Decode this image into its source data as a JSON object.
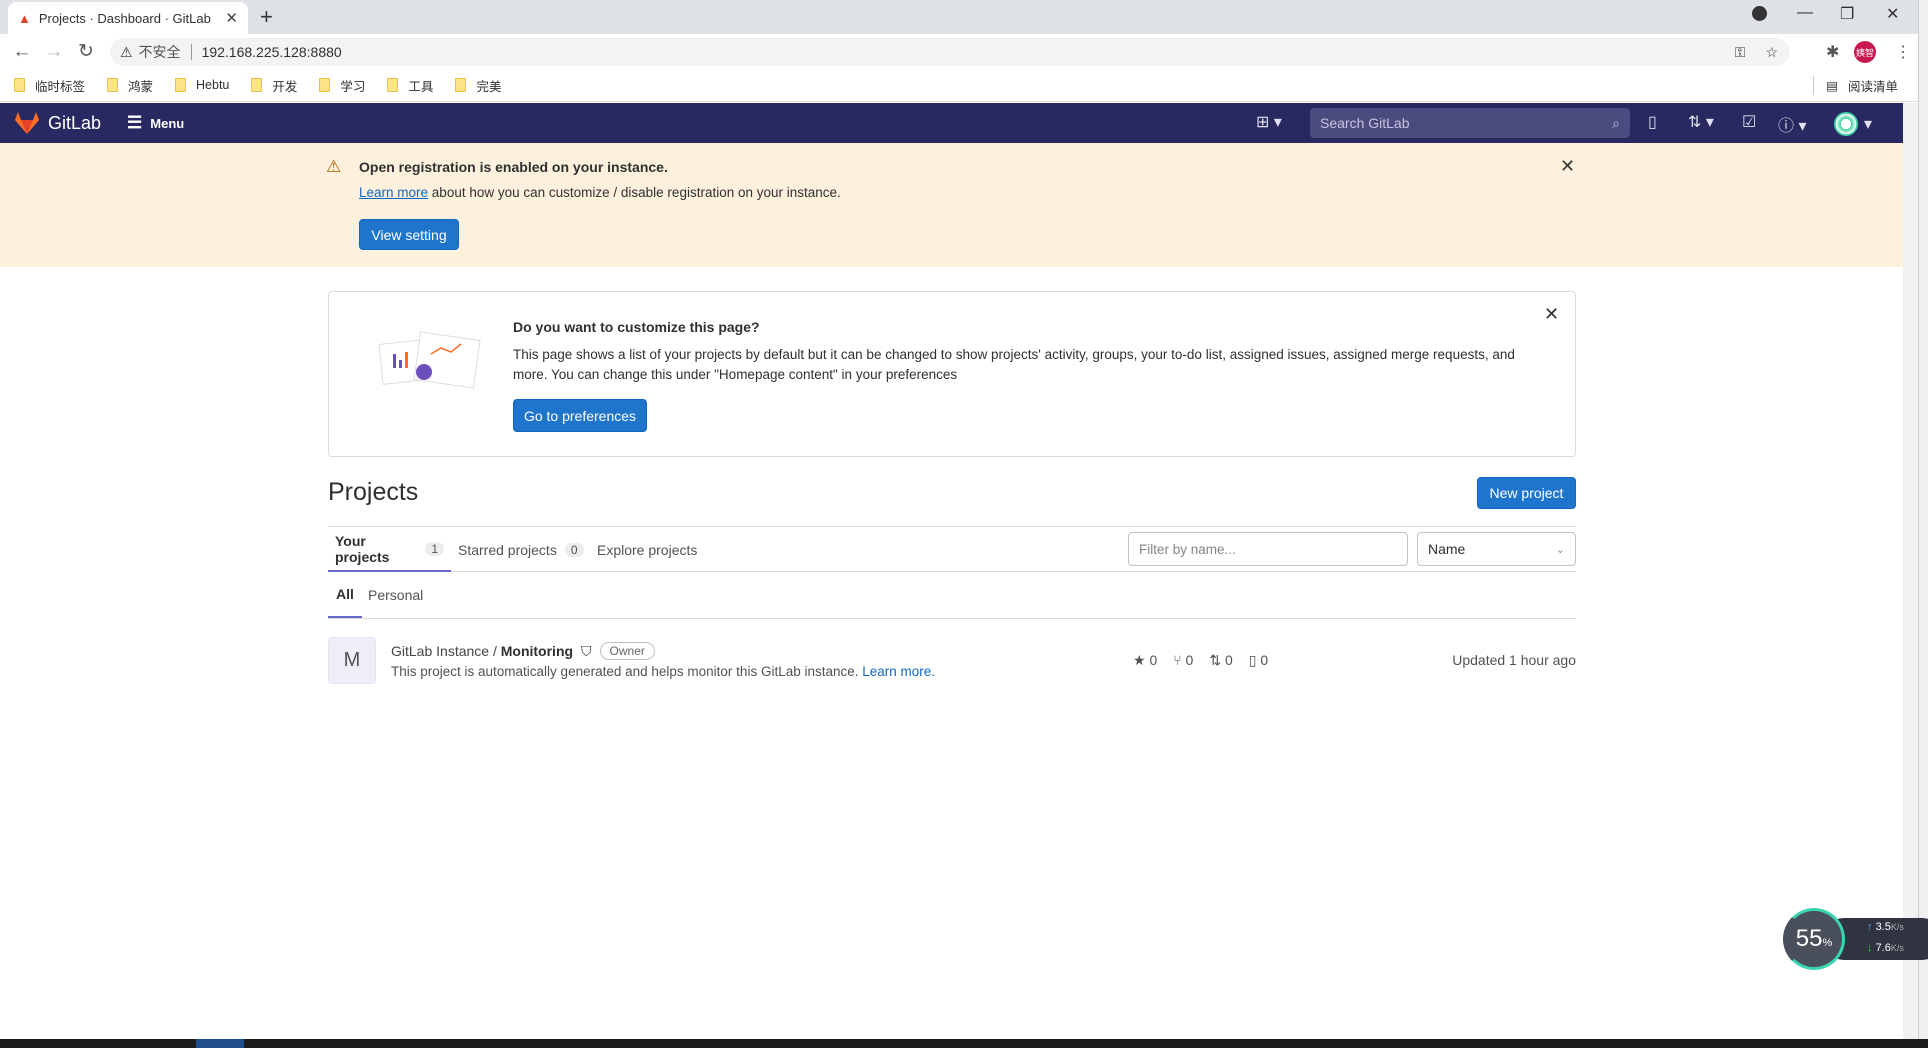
{
  "browser": {
    "tab_title": "Projects · Dashboard · GitLab",
    "security_label": "不安全",
    "url": "192.168.225.128:8880",
    "profile_label": "姨智",
    "reading_list": "阅读清单",
    "bookmarks": [
      "临时标签",
      "鸿蒙",
      "Hebtu",
      "开发",
      "学习",
      "工具",
      "完美"
    ]
  },
  "navbar": {
    "brand": "GitLab",
    "menu": "Menu",
    "search_placeholder": "Search GitLab"
  },
  "banner": {
    "title": "Open registration is enabled on your instance.",
    "link": "Learn more",
    "text": " about how you can customize / disable registration on your instance.",
    "button": "View setting"
  },
  "customize": {
    "title": "Do you want to customize this page?",
    "text": "This page shows a list of your projects by default but it can be changed to show projects' activity, groups, your to-do list, assigned issues, assigned merge requests, and more. You can change this under \"Homepage content\" in your preferences",
    "button": "Go to preferences"
  },
  "projects": {
    "title": "Projects",
    "new_button": "New project",
    "tabs": [
      {
        "label": "Your projects",
        "count": "1"
      },
      {
        "label": "Starred projects",
        "count": "0"
      },
      {
        "label": "Explore projects"
      }
    ],
    "filter_placeholder": "Filter by name...",
    "sort": "Name",
    "subtabs": [
      "All",
      "Personal"
    ],
    "items": [
      {
        "avatar": "M",
        "namespace": "GitLab Instance / ",
        "name": "Monitoring",
        "role": "Owner",
        "description": "This project is automatically generated and helps monitor this GitLab instance. ",
        "desc_link": "Learn more.",
        "stars": "0",
        "forks": "0",
        "merge_requests": "0",
        "issues": "0",
        "updated": "Updated 1 hour ago"
      }
    ]
  },
  "widget": {
    "percent": "55",
    "unit": "%",
    "up": "3.5",
    "down": "7.6",
    "rate_unit": "K/s"
  },
  "colors": {
    "navbar": "#292961",
    "primary": "#1f75cb",
    "banner": "#fdf1dd"
  }
}
